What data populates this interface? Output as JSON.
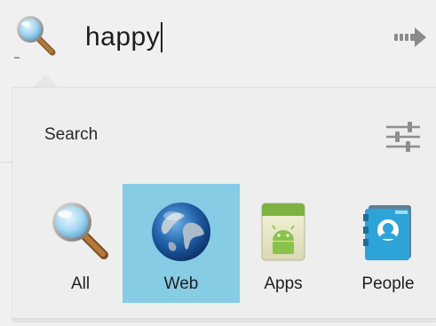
{
  "search_bar": {
    "query": "happy",
    "scope_icon": "search-magnifier-icon",
    "go_icon": "arrow-right-icon"
  },
  "panel": {
    "title": "Search",
    "settings_icon": "sliders-icon",
    "corpora": [
      {
        "label": "All",
        "icon": "magnifier-icon",
        "selected": false
      },
      {
        "label": "Web",
        "icon": "globe-icon",
        "selected": true
      },
      {
        "label": "Apps",
        "icon": "android-market-icon",
        "selected": false
      },
      {
        "label": "People",
        "icon": "contacts-icon",
        "selected": false
      }
    ]
  },
  "colors": {
    "selected_background": "#86cce5",
    "panel_background": "#eeeeee",
    "bar_background": "#f0f0f0"
  }
}
